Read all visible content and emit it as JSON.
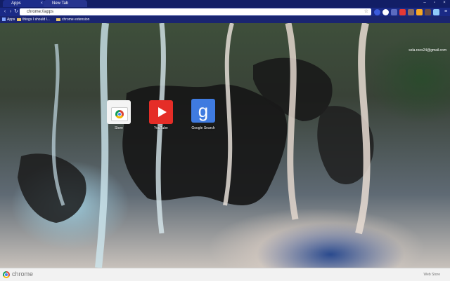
{
  "tabs": [
    {
      "label": "Apps",
      "active": true
    },
    {
      "label": "New Tab",
      "active": false
    }
  ],
  "omnibox": {
    "url": "chrome://apps"
  },
  "bookmarks": [
    {
      "label": "Apps"
    },
    {
      "label": "things I should l..."
    },
    {
      "label": "chrome extension"
    }
  ],
  "user": {
    "email": "sela.rees24@gmail.com"
  },
  "apps": [
    {
      "name": "Store",
      "icon": "chrome-web-store-icon"
    },
    {
      "name": "YouTube",
      "icon": "youtube-icon"
    },
    {
      "name": "Google Search",
      "icon": "google-search-icon"
    }
  ],
  "bottom_bar": {
    "brand": "chrome",
    "right_link": "Web Store"
  },
  "colors": {
    "frame": "#121e66",
    "tab_active": "#1d2d8a",
    "bottom_bar": "#f2f2f2"
  }
}
